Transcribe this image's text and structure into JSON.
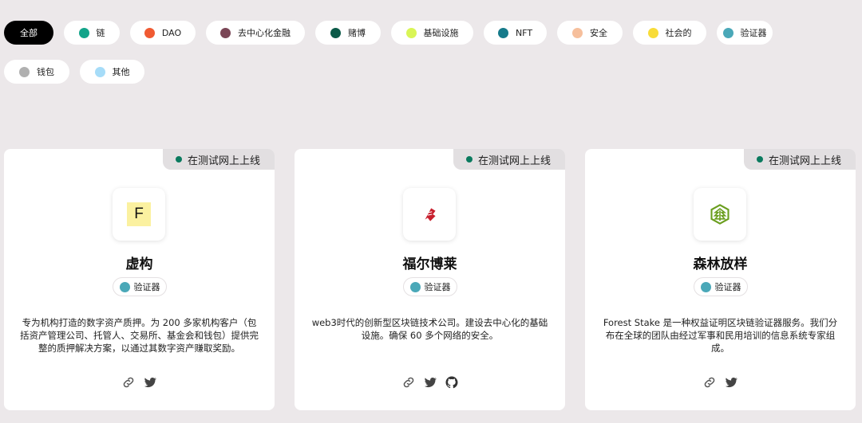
{
  "filters": {
    "row1": [
      {
        "label": "全部",
        "color": "",
        "active": true
      },
      {
        "label": "链",
        "color": "#13a48a"
      },
      {
        "label": "DAO",
        "color": "#f05a32"
      },
      {
        "label": "去中心化金融",
        "color": "#7a4656"
      },
      {
        "label": "赌博",
        "color": "#0b5a48"
      },
      {
        "label": "基础设施",
        "color": "#d9f556"
      },
      {
        "label": "NFT",
        "color": "#167a8a"
      },
      {
        "label": "安全",
        "color": "#f6bf9c"
      },
      {
        "label": "社会的",
        "color": "#f8dc38"
      },
      {
        "label": "验证器",
        "color": "#4aa8b8"
      }
    ],
    "row2": [
      {
        "label": "钱包",
        "color": "#b0b0b0"
      },
      {
        "label": "其他",
        "color": "#a6dcf8"
      }
    ]
  },
  "cards": [
    {
      "status": "在测试网上上线",
      "name": "虚构",
      "category": "验证器",
      "category_color": "#4aa8b8",
      "description": "专为机构打造的数字资产质押。为 200 多家机构客户（包括资产管理公司、托管人、交易所、基金会和钱包）提供完整的质押解决方案，以通过其数字资产赚取奖励。",
      "logo_letter": "F",
      "logo_icon": "fictional-f-logo",
      "links": [
        "link-icon",
        "twitter-icon"
      ]
    },
    {
      "status": "在测试网上上线",
      "name": "福尔博莱",
      "category": "验证器",
      "category_color": "#4aa8b8",
      "description": "web3时代的创新型区块链技术公司。建设去中心化的基础设施。确保 60 多个网络的安全。",
      "logo_icon": "red-bird-logo",
      "links": [
        "link-icon",
        "twitter-icon",
        "github-icon"
      ]
    },
    {
      "status": "在测试网上上线",
      "name": "森林放样",
      "category": "验证器",
      "category_color": "#4aa8b8",
      "description": "Forest Stake 是一种权益证明区块链验证器服务。我们分布在全球的团队由经过军事和民用培训的信息系统专家组成。",
      "logo_icon": "green-tree-logo",
      "links": [
        "link-icon",
        "twitter-icon"
      ]
    }
  ]
}
